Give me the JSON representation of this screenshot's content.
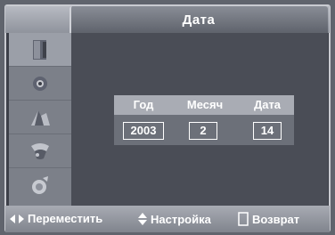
{
  "title": "Дата",
  "sidebar": {
    "items": [
      {
        "icon": "picture-icon"
      },
      {
        "icon": "sound-icon"
      },
      {
        "icon": "channel-icon"
      },
      {
        "icon": "setup-icon"
      },
      {
        "icon": "input-icon"
      }
    ]
  },
  "date": {
    "year_label": "Год",
    "month_label": "Месяч",
    "day_label": "Дата",
    "year": "2003",
    "month": "2",
    "day": "14"
  },
  "footer": {
    "move": "Переместить",
    "adjust": "Настройка",
    "back": "Возврат"
  }
}
